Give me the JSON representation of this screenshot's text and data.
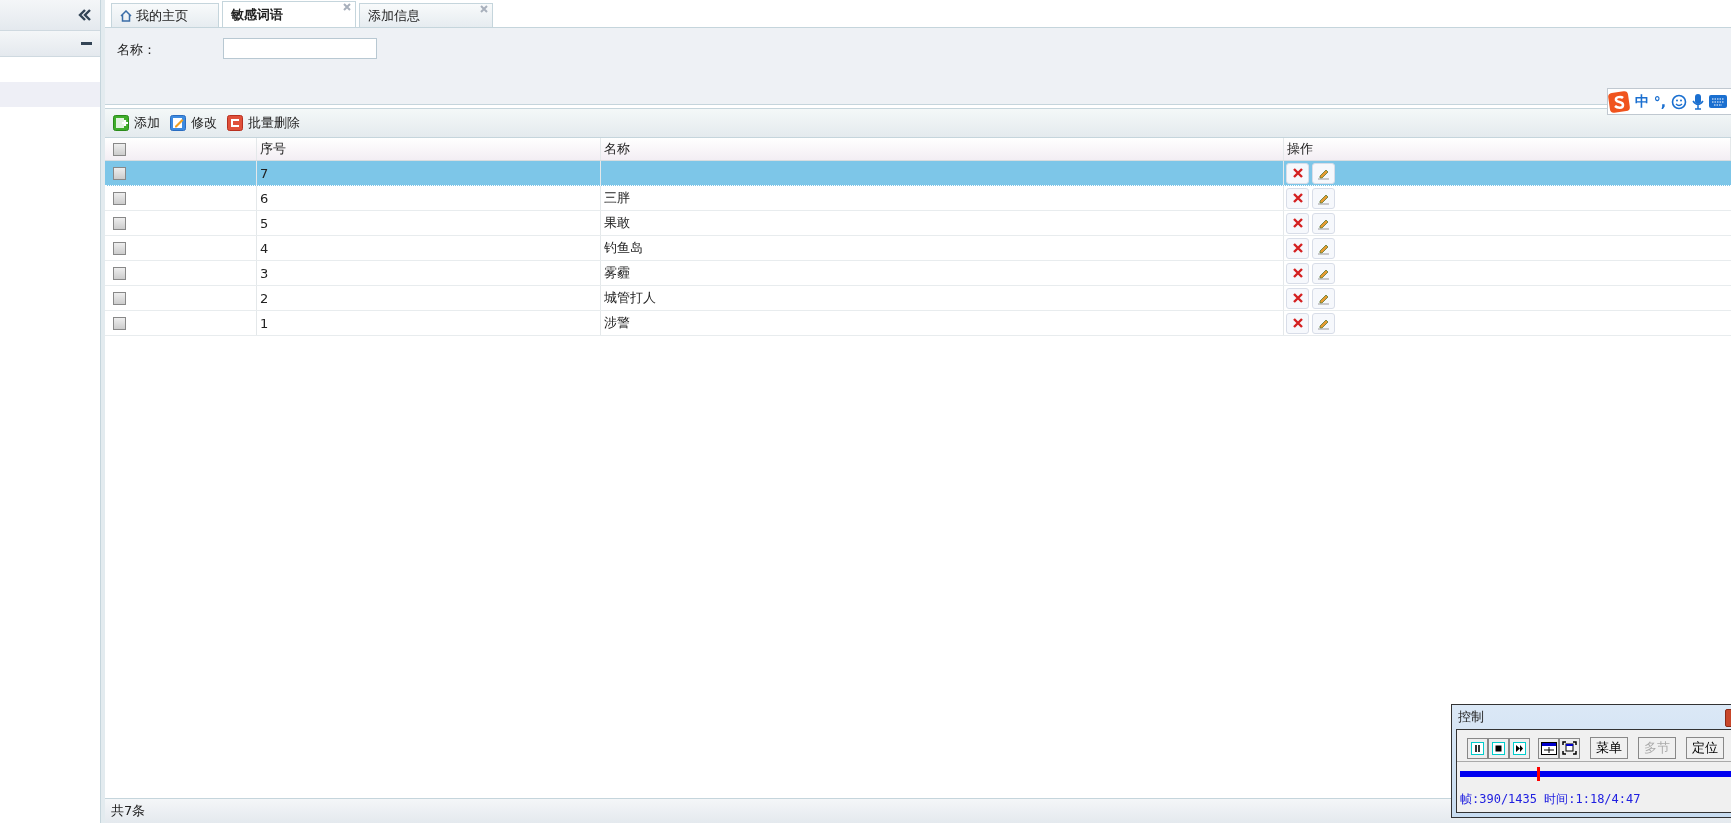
{
  "tabs": [
    {
      "label": "我的主页",
      "kind": "home",
      "selected": false,
      "closable": false
    },
    {
      "label": "敏感词语",
      "kind": "plain",
      "selected": true,
      "closable": true
    },
    {
      "label": "添加信息",
      "kind": "plain",
      "selected": false,
      "closable": true
    }
  ],
  "sidebar": {
    "items": [
      {
        "selected": true
      }
    ]
  },
  "search": {
    "label": "名称："
  },
  "toolbar": [
    {
      "label": "添加",
      "kind": "add"
    },
    {
      "label": "修改",
      "kind": "edit"
    },
    {
      "label": "批量删除",
      "kind": "delete"
    }
  ],
  "table": {
    "select_all_checked": false,
    "columns": [
      "序号",
      "名称",
      "操作"
    ],
    "rows": [
      {
        "no": "7",
        "selected": true,
        "checked": false
      },
      {
        "no": "6",
        "name": "三胖",
        "selected": false,
        "checked": false
      },
      {
        "no": "5",
        "name": "果敢",
        "selected": false,
        "checked": false
      },
      {
        "no": "4",
        "name": "钓鱼岛",
        "selected": false,
        "checked": false
      },
      {
        "no": "3",
        "name": "雾霾",
        "selected": false,
        "checked": false
      },
      {
        "no": "2",
        "name": "城管打人",
        "selected": false,
        "checked": false
      },
      {
        "no": "1",
        "name": "涉警",
        "selected": false,
        "checked": false
      }
    ]
  },
  "status_bar": {
    "total": "共7条"
  },
  "ime_toolbar": {
    "mode": "中",
    "punct": "°,"
  },
  "control_window": {
    "title": "控制",
    "buttons": [
      {
        "label": "菜单",
        "disabled": false
      },
      {
        "label": "多节",
        "disabled": true
      },
      {
        "label": "定位",
        "disabled": false
      }
    ],
    "level": 0.27,
    "status": "帧:390/1435 时间:1:18/4:47"
  }
}
